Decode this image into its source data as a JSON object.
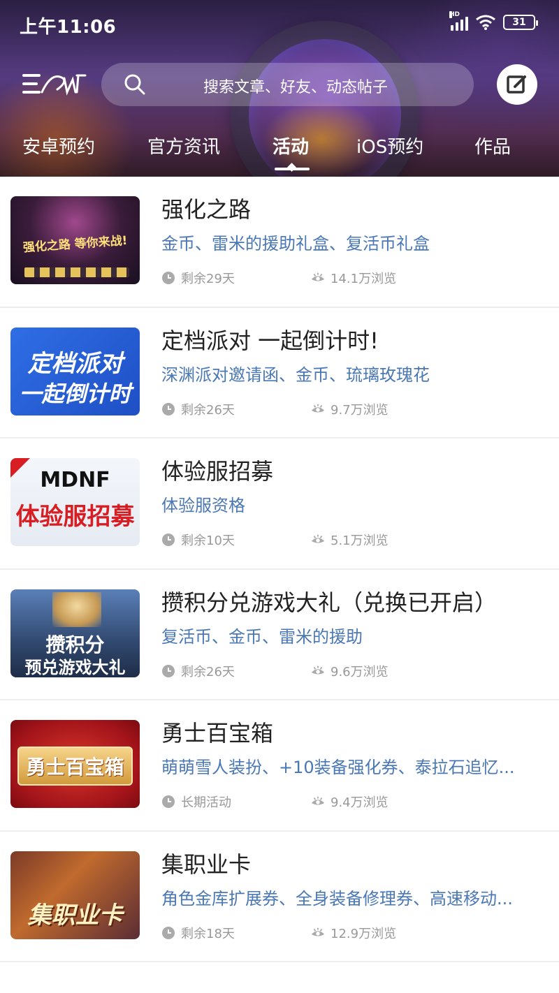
{
  "status_bar": {
    "time": "上午11:06",
    "network_label": "HD",
    "battery": "31"
  },
  "header": {
    "search_placeholder": "搜索文章、好友、动态帖子"
  },
  "tabs": [
    {
      "label": "安卓预约"
    },
    {
      "label": "官方资讯"
    },
    {
      "label": "活动",
      "active": true
    },
    {
      "label": "iOS预约"
    },
    {
      "label": "作品"
    }
  ],
  "items": [
    {
      "title": "强化之路",
      "rewards": "金币、雷米的援助礼盒、复活币礼盒",
      "remaining": "剩余29天",
      "views": "14.1万浏览",
      "thumb_text": "强化之路 等你来战!"
    },
    {
      "title": "定档派对 一起倒计时!",
      "rewards": "深渊派对邀请函、金币、琉璃玫瑰花",
      "remaining": "剩余26天",
      "views": "9.7万浏览",
      "thumb_text_1": "定档派对",
      "thumb_text_2": "一起倒计时"
    },
    {
      "title": "体验服招募",
      "rewards": "体验服资格",
      "remaining": "剩余10天",
      "views": "5.1万浏览",
      "thumb_text_1": "MDNF",
      "thumb_text_2": "体验服招募"
    },
    {
      "title": "攒积分兑游戏大礼（兑换已开启）",
      "rewards": "复活币、金币、雷米的援助",
      "remaining": "剩余26天",
      "views": "9.6万浏览",
      "thumb_text_1": "攒积分",
      "thumb_text_2": "预兑游戏大礼"
    },
    {
      "title": "勇士百宝箱",
      "rewards": "萌萌雪人装扮、+10装备强化券、泰拉石追忆...",
      "remaining": "长期活动",
      "views": "9.4万浏览",
      "thumb_text": "勇士百宝箱"
    },
    {
      "title": "集职业卡",
      "rewards": "角色金库扩展券、全身装备修理券、高速移动...",
      "remaining": "剩余18天",
      "views": "12.9万浏览",
      "thumb_text": "集职业卡"
    }
  ],
  "colors": {
    "link_blue": "#4a78b5",
    "meta_gray": "#999999",
    "title_dark": "#222222"
  }
}
